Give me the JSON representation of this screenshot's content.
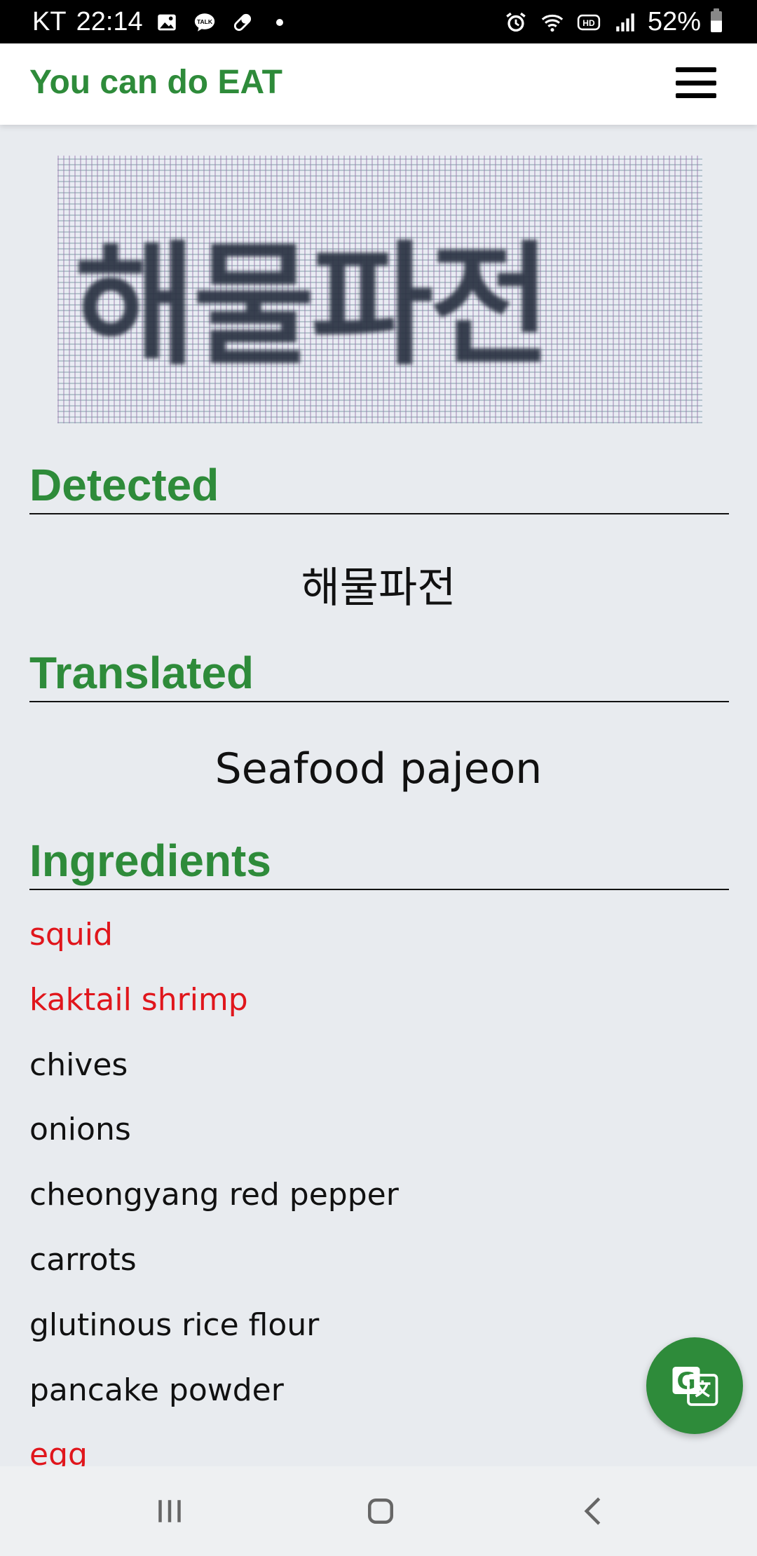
{
  "status_bar": {
    "carrier": "KT",
    "time": "22:14",
    "battery": "52%",
    "left_icons": [
      "image-icon",
      "talk-icon",
      "pill-icon"
    ],
    "right_icons": [
      "alarm-icon",
      "wifi-icon",
      "hd-icon",
      "signal-icon",
      "battery-icon"
    ],
    "talk_label": "TALK",
    "hd_label": "HD"
  },
  "app_bar": {
    "title": "You can do EAT",
    "menu_icon": "hamburger-menu-icon"
  },
  "capture": {
    "text": "해물파전"
  },
  "detected": {
    "heading": "Detected",
    "value": "해물파전"
  },
  "translated": {
    "heading": "Translated",
    "value": "Seafood pajeon"
  },
  "ingredients": {
    "heading": "Ingredients",
    "items": [
      {
        "name": "squid",
        "allergen": true
      },
      {
        "name": "kaktail shrimp",
        "allergen": true
      },
      {
        "name": "chives",
        "allergen": false
      },
      {
        "name": "onions",
        "allergen": false
      },
      {
        "name": "cheongyang red pepper",
        "allergen": false
      },
      {
        "name": "carrots",
        "allergen": false
      },
      {
        "name": "glutinous rice flour",
        "allergen": false
      },
      {
        "name": "pancake powder",
        "allergen": false
      },
      {
        "name": "egg",
        "allergen": true
      }
    ]
  },
  "fab": {
    "icon": "translate-icon"
  },
  "nav_bar": {
    "buttons": [
      "recent-apps-icon",
      "home-icon",
      "back-icon"
    ]
  },
  "colors": {
    "brand_green": "#2e8b3a",
    "allergen_red": "#e0161c",
    "background": "#e8ebef"
  }
}
